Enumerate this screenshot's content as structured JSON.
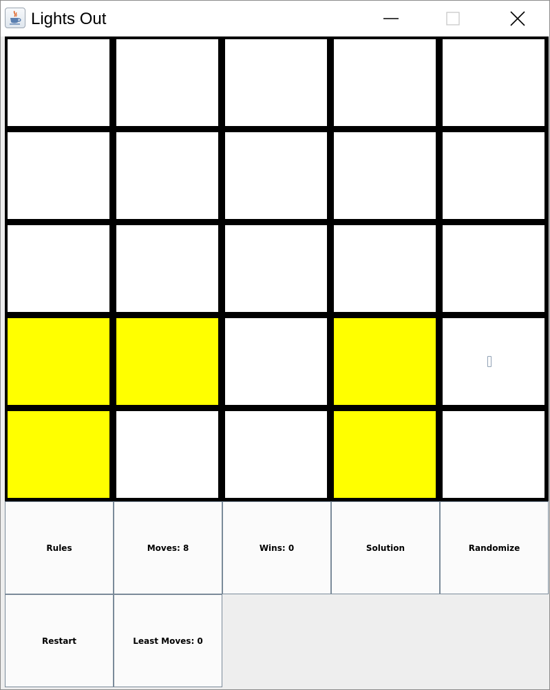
{
  "window": {
    "title": "Lights Out"
  },
  "board": {
    "rows": 5,
    "cols": 5,
    "cells": [
      [
        false,
        false,
        false,
        false,
        false
      ],
      [
        false,
        false,
        false,
        false,
        false
      ],
      [
        false,
        false,
        false,
        false,
        false
      ],
      [
        true,
        true,
        false,
        true,
        false
      ],
      [
        true,
        false,
        false,
        true,
        false
      ]
    ],
    "on_color": "#ffff00",
    "off_color": "#ffffff",
    "grid_color": "#000000"
  },
  "controls": {
    "rules_label": "Rules",
    "moves_label": "Moves: 8",
    "wins_label": "Wins: 0",
    "solution_label": "Solution",
    "randomize_label": "Randomize",
    "restart_label": "Restart",
    "least_moves_label": "Least Moves: 0"
  },
  "icons": {
    "app": "java-coffee-cup-icon",
    "minimize": "minimize-icon",
    "maximize": "maximize-icon",
    "close": "close-icon",
    "cursor": "text-cursor-icon"
  }
}
